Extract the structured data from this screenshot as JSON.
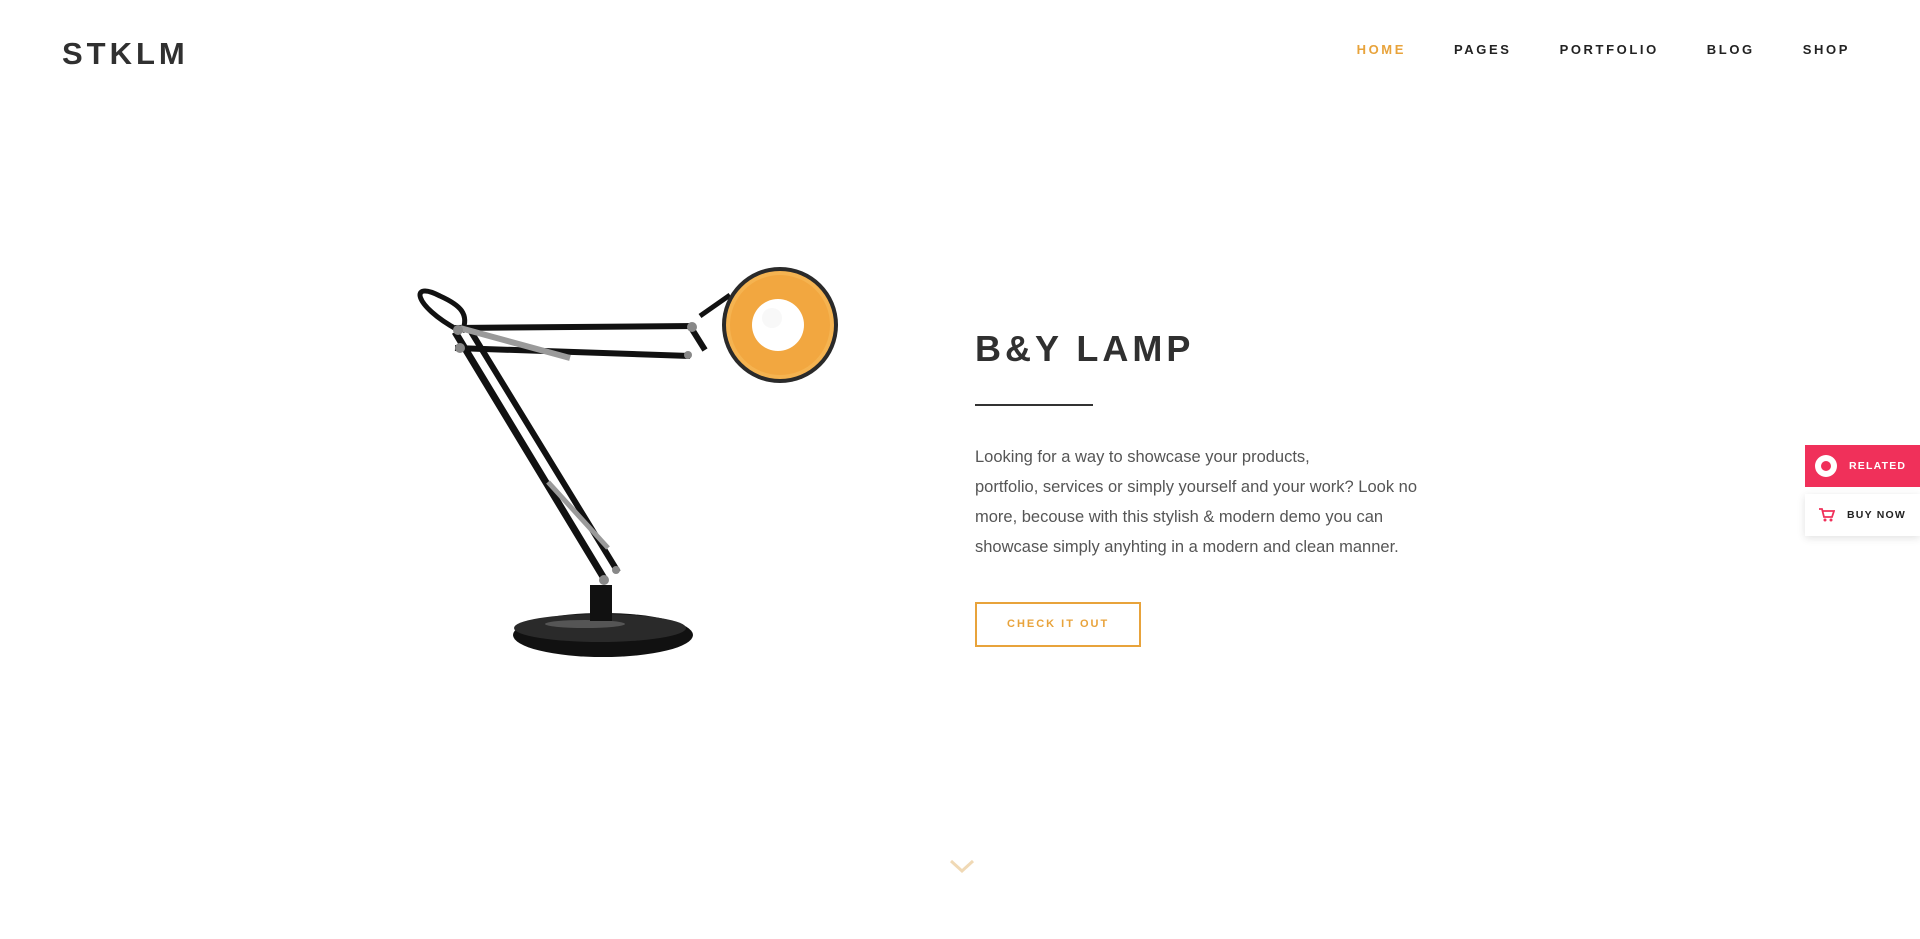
{
  "brand": {
    "logo_text": "STKLM"
  },
  "nav": {
    "items": [
      {
        "label": "HOME",
        "active": true
      },
      {
        "label": "PAGES",
        "active": false
      },
      {
        "label": "PORTFOLIO",
        "active": false
      },
      {
        "label": "BLOG",
        "active": false
      },
      {
        "label": "SHOP",
        "active": false
      }
    ]
  },
  "hero": {
    "title": "B&Y LAMP",
    "description_lines": [
      "Looking for a way to showcase your products,",
      "portfolio, services or simply yourself and your work? Look no",
      "more, becouse with this stylish & modern demo you can",
      "showcase simply anyhting in a modern and clean manner."
    ],
    "cta_label": "CHECK IT OUT"
  },
  "side_widgets": {
    "related_label": "RELATED",
    "buy_label": "BUY NOW"
  },
  "icons": {
    "scroll": "chevron-down-icon",
    "related": "ring-icon",
    "buy": "cart-icon"
  },
  "colors": {
    "accent": "#e8a33b",
    "related_bg": "#f0305a",
    "text_dark": "#303030"
  }
}
